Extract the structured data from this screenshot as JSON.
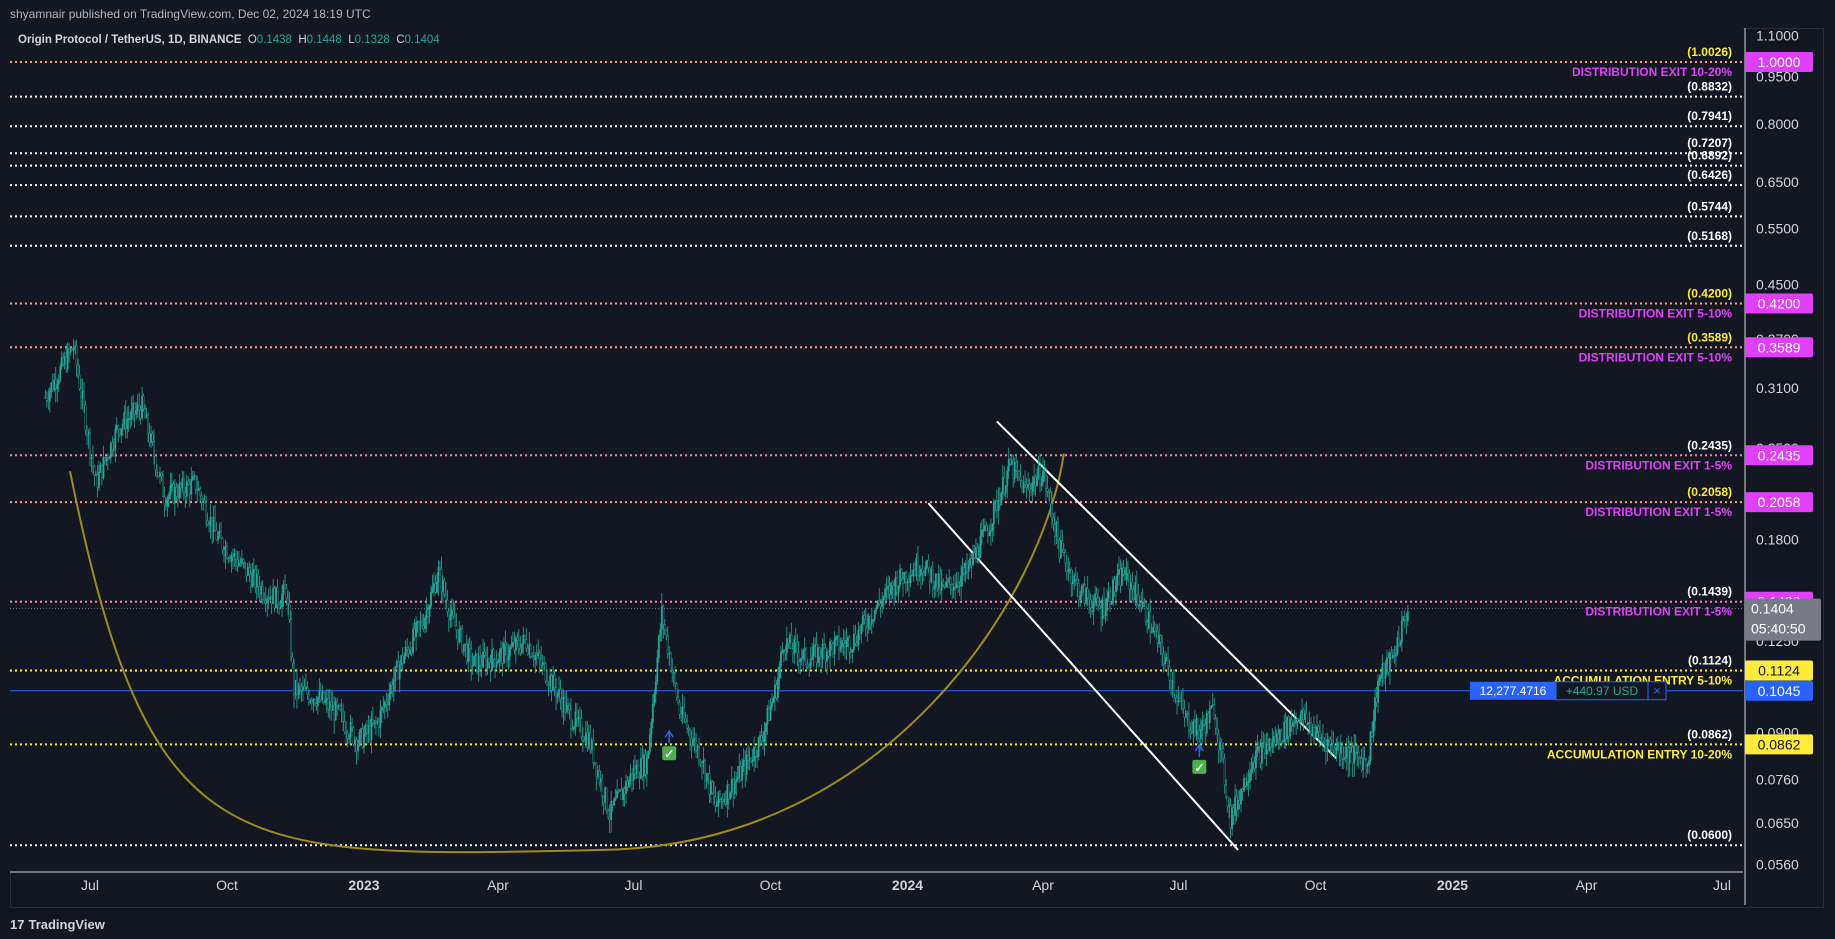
{
  "header": {
    "publisher_line": "shyamnair published on TradingView.com, Dec 02, 2024 18:19 UTC"
  },
  "legend": {
    "symbol": "Origin Protocol / TetherUS, 1D, BINANCE",
    "o_label": "O",
    "o": "0.1438",
    "h_label": "H",
    "h": "0.1448",
    "l_label": "L",
    "l": "0.1328",
    "c_label": "C",
    "c": "0.1404"
  },
  "footer": {
    "brand": "TradingView",
    "brand_mark": "17"
  },
  "position_tool": {
    "qty": "12,277.4716",
    "pnl": "+440.97 USD",
    "close": "×"
  },
  "countdown": "05:40:50",
  "colors": {
    "background": "#131722",
    "candle_up": "#26a69a",
    "candle_down": "#26a69a",
    "distribution": "#e040fb",
    "accumulation": "#ffeb3b",
    "curve": "#a08a1c",
    "channel": "#ffffff",
    "position_line": "#2962ff"
  },
  "chart_data": {
    "type": "candlestick",
    "scale": "log",
    "ylim": [
      0.0545,
      1.13
    ],
    "x_tick_labels": [
      "Jul",
      "Oct",
      "2023",
      "Apr",
      "Jul",
      "Oct",
      "2024",
      "Apr",
      "Jul",
      "Oct",
      "2025",
      "Apr",
      "Jul"
    ],
    "y_tick_labels": [
      "1.1000",
      "0.9500",
      "0.8000",
      "0.6500",
      "0.5500",
      "0.4500",
      "0.3700",
      "0.3100",
      "0.2500",
      "0.1800",
      "0.1250",
      "0.0900",
      "0.0760",
      "0.0650",
      "0.0560"
    ],
    "y_tick_values": [
      1.1,
      0.95,
      0.8,
      0.65,
      0.55,
      0.45,
      0.37,
      0.31,
      0.25,
      0.18,
      0.125,
      0.09,
      0.076,
      0.065,
      0.056
    ],
    "price_series": {
      "note": "approximate daily closes read from chart, Jun 2022 – Dec 2024",
      "points": [
        [
          "2022-06-01",
          0.3
        ],
        [
          "2022-06-20",
          0.36
        ],
        [
          "2022-07-05",
          0.22
        ],
        [
          "2022-07-20",
          0.27
        ],
        [
          "2022-08-05",
          0.29
        ],
        [
          "2022-08-20",
          0.21
        ],
        [
          "2022-09-10",
          0.22
        ],
        [
          "2022-09-25",
          0.18
        ],
        [
          "2022-10-10",
          0.165
        ],
        [
          "2022-10-25",
          0.15
        ],
        [
          "2022-11-05",
          0.145
        ],
        [
          "2022-11-10",
          0.15
        ],
        [
          "2022-11-15",
          0.105
        ],
        [
          "2022-12-01",
          0.102
        ],
        [
          "2022-12-15",
          0.096
        ],
        [
          "2022-12-28",
          0.087
        ],
        [
          "2023-01-10",
          0.093
        ],
        [
          "2023-01-25",
          0.115
        ],
        [
          "2023-02-10",
          0.135
        ],
        [
          "2023-02-20",
          0.16
        ],
        [
          "2023-03-01",
          0.135
        ],
        [
          "2023-03-15",
          0.115
        ],
        [
          "2023-04-01",
          0.118
        ],
        [
          "2023-04-20",
          0.125
        ],
        [
          "2023-05-05",
          0.11
        ],
        [
          "2023-05-20",
          0.095
        ],
        [
          "2023-06-01",
          0.088
        ],
        [
          "2023-06-15",
          0.067
        ],
        [
          "2023-07-01",
          0.078
        ],
        [
          "2023-07-10",
          0.081
        ],
        [
          "2023-07-20",
          0.138
        ],
        [
          "2023-08-01",
          0.097
        ],
        [
          "2023-08-15",
          0.083
        ],
        [
          "2023-08-25",
          0.069
        ],
        [
          "2023-09-10",
          0.077
        ],
        [
          "2023-09-25",
          0.088
        ],
        [
          "2023-10-05",
          0.106
        ],
        [
          "2023-10-10",
          0.125
        ],
        [
          "2023-10-25",
          0.117
        ],
        [
          "2023-11-10",
          0.122
        ],
        [
          "2023-11-25",
          0.125
        ],
        [
          "2023-12-10",
          0.14
        ],
        [
          "2023-12-25",
          0.155
        ],
        [
          "2024-01-10",
          0.165
        ],
        [
          "2024-01-25",
          0.15
        ],
        [
          "2024-02-10",
          0.16
        ],
        [
          "2024-02-25",
          0.19
        ],
        [
          "2024-03-10",
          0.235
        ],
        [
          "2024-03-20",
          0.215
        ],
        [
          "2024-04-01",
          0.23
        ],
        [
          "2024-04-12",
          0.175
        ],
        [
          "2024-04-25",
          0.15
        ],
        [
          "2024-05-10",
          0.14
        ],
        [
          "2024-05-25",
          0.16
        ],
        [
          "2024-06-05",
          0.145
        ],
        [
          "2024-06-20",
          0.12
        ],
        [
          "2024-07-05",
          0.095
        ],
        [
          "2024-07-15",
          0.09
        ],
        [
          "2024-07-25",
          0.098
        ],
        [
          "2024-08-05",
          0.066
        ],
        [
          "2024-08-20",
          0.082
        ],
        [
          "2024-09-05",
          0.088
        ],
        [
          "2024-09-20",
          0.096
        ],
        [
          "2024-10-05",
          0.088
        ],
        [
          "2024-10-20",
          0.084
        ],
        [
          "2024-11-05",
          0.081
        ],
        [
          "2024-11-12",
          0.108
        ],
        [
          "2024-11-22",
          0.118
        ],
        [
          "2024-12-02",
          0.1404
        ]
      ]
    },
    "levels": [
      {
        "price": 1.0,
        "label": "(1.0026)",
        "label_color": "#ffeb3b",
        "line": "#ff9e80",
        "tag": "DISTRIBUTION EXIT 10-20%",
        "axis_tag": "1.0000",
        "axis_bg": "#e040fb"
      },
      {
        "price": 0.8832,
        "label": "(0.8832)",
        "line": "#ffffff"
      },
      {
        "price": 0.7941,
        "label": "(0.7941)",
        "line": "#ffffff"
      },
      {
        "price": 0.7207,
        "label": "(0.7207)",
        "line": "#ffffff"
      },
      {
        "price": 0.6892,
        "label": "(0.6892)",
        "line": "#ffffff"
      },
      {
        "price": 0.6426,
        "label": "(0.6426)",
        "line": "#ffffff"
      },
      {
        "price": 0.5744,
        "label": "(0.5744)",
        "line": "#ffffff"
      },
      {
        "price": 0.5168,
        "label": "(0.5168)",
        "line": "#ffffff"
      },
      {
        "price": 0.42,
        "label": "(0.4200)",
        "label_color": "#ffeb3b",
        "line": "#ff9e80",
        "tag": "DISTRIBUTION EXIT 5-10%",
        "axis_tag": "0.4200",
        "axis_bg": "#e040fb"
      },
      {
        "price": 0.3589,
        "label": "(0.3589)",
        "label_color": "#ffeb3b",
        "line": "#ff9e80",
        "tag": "DISTRIBUTION EXIT 5-10%",
        "axis_tag": "0.3589",
        "axis_bg": "#e040fb"
      },
      {
        "price": 0.2435,
        "label": "(0.2435)",
        "line": "#ff80ab",
        "tag": "DISTRIBUTION EXIT 1-5%",
        "axis_tag": "0.2435",
        "axis_bg": "#e040fb"
      },
      {
        "price": 0.2058,
        "label": "(0.2058)",
        "label_color": "#ffeb3b",
        "line": "#ff9e80",
        "tag": "DISTRIBUTION EXIT 1-5%",
        "axis_tag": "0.2058",
        "axis_bg": "#e040fb"
      },
      {
        "price": 0.1439,
        "label": "(0.1439)",
        "line": "#ff80ab",
        "tag": "DISTRIBUTION EXIT 1-5%",
        "axis_tag": "0.1439",
        "axis_bg": "#e040fb"
      },
      {
        "price": 0.1124,
        "label": "(0.1124)",
        "line": "#ffeb3b",
        "tag": "ACCUMULATION ENTRY 5-10%",
        "tag_color": "#ffeb3b",
        "axis_tag": "0.1124",
        "axis_bg": "#ffeb3b"
      },
      {
        "price": 0.0862,
        "label": "(0.0862)",
        "line": "#ffeb3b",
        "tag": "ACCUMULATION ENTRY 10-20%",
        "tag_color": "#ffeb3b",
        "axis_tag": "0.0862",
        "axis_bg": "#ffeb3b"
      },
      {
        "price": 0.06,
        "label": "(0.0600)",
        "line": "#ffffff"
      }
    ],
    "last_price": {
      "value": "0.1404"
    },
    "position_price": {
      "value": "0.1045"
    }
  }
}
